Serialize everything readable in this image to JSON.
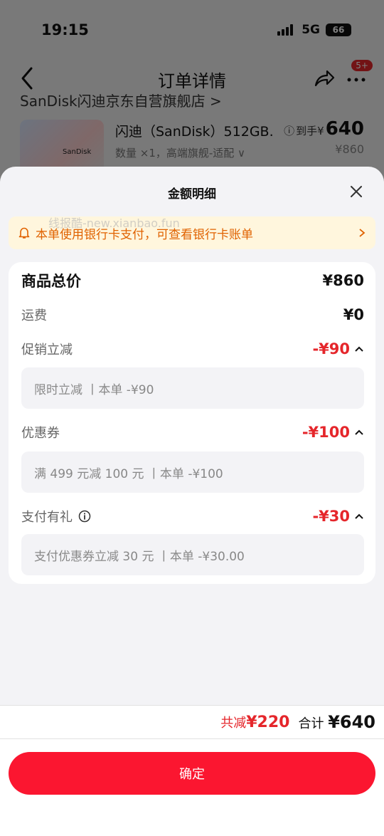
{
  "status_bar": {
    "time": "19:15",
    "network": "5G",
    "battery": "66"
  },
  "nav": {
    "title": "订单详情",
    "badge": "5+"
  },
  "store": {
    "name": "SanDisk闪迪京东自营旗舰店 >"
  },
  "product": {
    "name": "闪迪（SanDisk）512GB.",
    "spec": "数量 ×1，高端旗舰-适配 ∨",
    "price_prefix": "到手¥",
    "price": "640",
    "original_price": "¥860",
    "thumb_text": "SanDisk"
  },
  "sheet": {
    "title": "金额明细",
    "notice": "本单使用银行卡支付，可查看银行卡账单",
    "watermark": "线报酷-new.xianbao.fun"
  },
  "breakdown": {
    "total_label": "商品总价",
    "total_value": "¥860",
    "shipping_label": "运费",
    "shipping_value": "¥0",
    "promo_label": "促销立减",
    "promo_value": "-¥90",
    "promo_detail": "限时立减 丨本单 -¥90",
    "coupon_label": "优惠券",
    "coupon_value": "-¥100",
    "coupon_detail": "满 499 元减 100 元 丨本单 -¥100",
    "pay_gift_label": "支付有礼",
    "pay_gift_value": "-¥30",
    "pay_gift_detail": "支付优惠券立减 30 元 丨本单 -¥30.00"
  },
  "summary": {
    "saved_label": "共减",
    "saved_value": "¥220",
    "total_label": "合计",
    "total_value": "¥640"
  },
  "confirm_label": "确定",
  "colors": {
    "accent_red": "#e5262b",
    "button_red": "#fb1630",
    "notice_orange": "#e06200"
  }
}
